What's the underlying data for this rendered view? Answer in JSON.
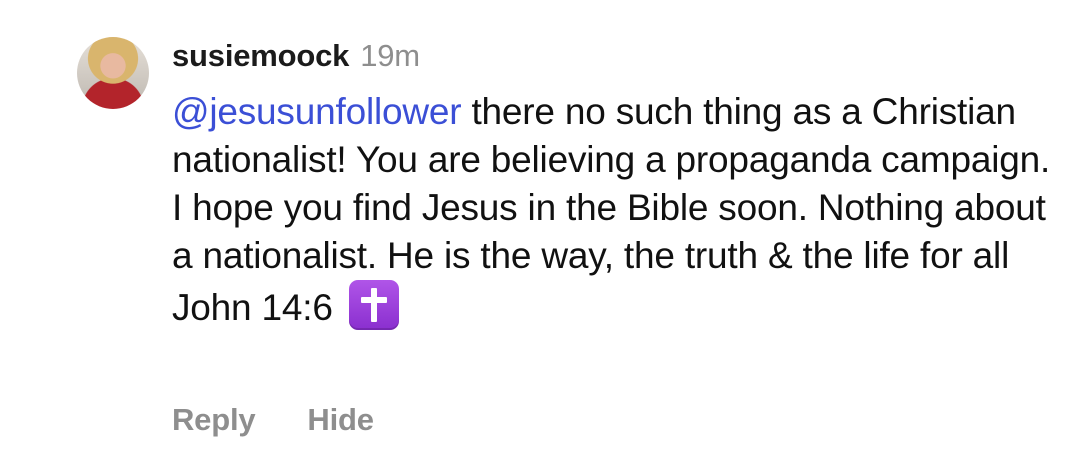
{
  "comment": {
    "username": "susiemoock",
    "timestamp": "19m",
    "mention": "@jesusunfollower",
    "text": " there no such thing as a Christian nationalist! You are believing a propaganda campaign. I hope you find Jesus in the Bible soon. Nothing about a nationalist. He is the way, the truth & the life for all John 14:6 ",
    "emoji_icon": "latin-cross-icon",
    "colors": {
      "mention": "#3b4fd6",
      "secondary": "#8e8e8e",
      "emoji_bg": "#9b3fdc"
    }
  },
  "actions": {
    "reply_label": "Reply",
    "hide_label": "Hide"
  }
}
